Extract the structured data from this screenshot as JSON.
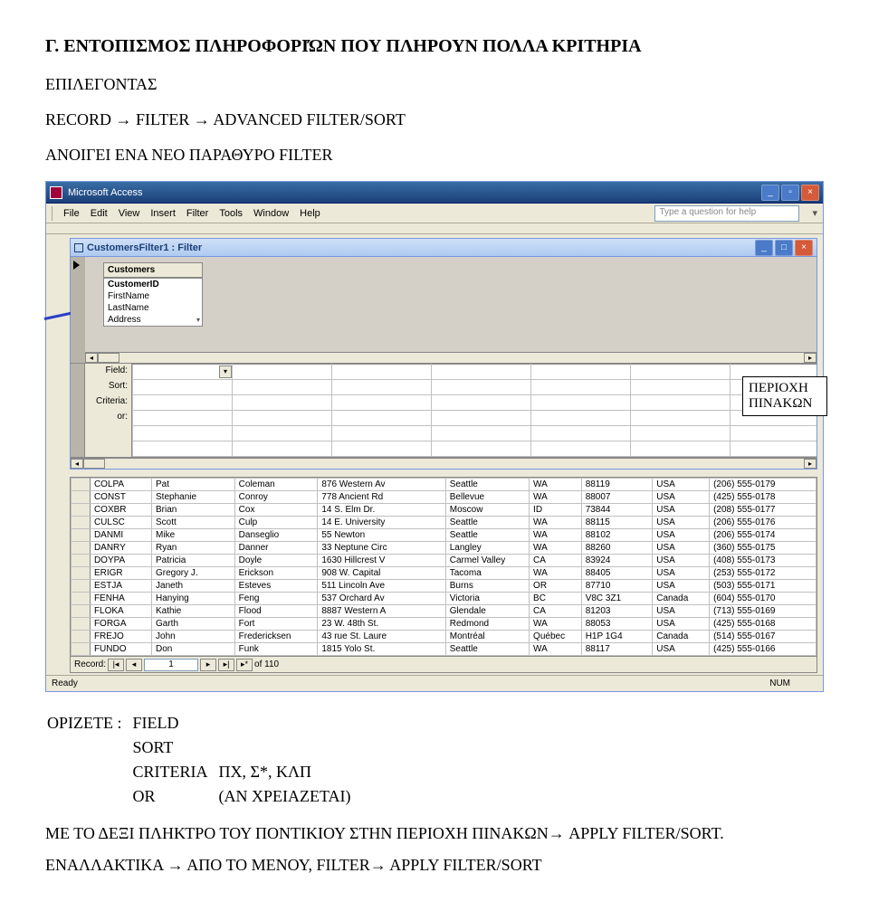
{
  "doc": {
    "heading": "Γ. ΕΝΤΟΠΙΣΜΟΣ ΠΛΗΡΟΦΟΡΙΏΝ ΠΟΥ ΠΛΗΡΟΥΝ ΠΟΛΛΑ ΚΡΙΤΗΡΙΑ",
    "subheading": "ΕΠΙΛΕΓΟΝΤΑΣ",
    "path": "RECORD → FILTER → ADVANCED FILTER/SORT",
    "opens": "ΑΝΟΙΓΕΙ ΕΝΑ ΝΕΟ ΠΑΡΑΘΥΡΟ FILTER",
    "callout": "ΠΕΡΙΟΧΗ ΠΙΝΑΚΩΝ",
    "defs_label": "ΟΡΙΖΕΤΕ :",
    "defs": [
      {
        "k": "FIELD",
        "v": ""
      },
      {
        "k": "SORT",
        "v": ""
      },
      {
        "k": "CRITERIA",
        "v": "ΠΧ, Σ*, ΚΛΠ"
      },
      {
        "k": "OR",
        "v": "(ΑΝ ΧΡΕΙΑΖΕΤΑΙ)"
      }
    ],
    "post1": "ΜΕ ΤΟ ΔΕΞΙ ΠΛΗΚΤΡΟ ΤΟΥ ΠΟΝΤΙΚΙΟΥ ΣΤΗΝ ΠΕΡΙΟΧΗ ΠΙΝΑΚΩΝ→ APPLY FILTER/SORT.",
    "post2": "ΕΝΑΛΛΑΚΤΙΚΑ → ΑΠΟ ΤΟ ΜΕΝΟΥ, FILTER→ APPLY FILTER/SORT"
  },
  "app": {
    "title": "Microsoft Access",
    "menus": [
      "File",
      "Edit",
      "View",
      "Insert",
      "Filter",
      "Tools",
      "Window",
      "Help"
    ],
    "helpbox": "Type a question for help",
    "sub_title": "CustomersFilter1 : Filter",
    "fields_header": "Customers",
    "fields": [
      "CustomerID",
      "FirstName",
      "LastName",
      "Address"
    ],
    "qbe_labels": [
      "Field:",
      "Sort:",
      "Criteria:",
      "or:"
    ],
    "record_label": "Record:",
    "record_no": "1",
    "record_of": "of  110",
    "status": "Ready",
    "num": "NUM"
  },
  "rows": [
    {
      "c1": "COLPA",
      "c2": "Pat",
      "c3": "Coleman",
      "c4": "876 Western Av",
      "c5": "Seattle",
      "c6": "WA",
      "c7": "88119",
      "c8": "USA",
      "c9": "(206) 555-0179"
    },
    {
      "c1": "CONST",
      "c2": "Stephanie",
      "c3": "Conroy",
      "c4": "778 Ancient Rd",
      "c5": "Bellevue",
      "c6": "WA",
      "c7": "88007",
      "c8": "USA",
      "c9": "(425) 555-0178"
    },
    {
      "c1": "COXBR",
      "c2": "Brian",
      "c3": "Cox",
      "c4": "14 S. Elm Dr.",
      "c5": "Moscow",
      "c6": "ID",
      "c7": "73844",
      "c8": "USA",
      "c9": "(208) 555-0177"
    },
    {
      "c1": "CULSC",
      "c2": "Scott",
      "c3": "Culp",
      "c4": "14 E. University",
      "c5": "Seattle",
      "c6": "WA",
      "c7": "88115",
      "c8": "USA",
      "c9": "(206) 555-0176"
    },
    {
      "c1": "DANMI",
      "c2": "Mike",
      "c3": "Danseglio",
      "c4": "55 Newton",
      "c5": "Seattle",
      "c6": "WA",
      "c7": "88102",
      "c8": "USA",
      "c9": "(206) 555-0174"
    },
    {
      "c1": "DANRY",
      "c2": "Ryan",
      "c3": "Danner",
      "c4": "33 Neptune Circ",
      "c5": "Langley",
      "c6": "WA",
      "c7": "88260",
      "c8": "USA",
      "c9": "(360) 555-0175"
    },
    {
      "c1": "DOYPA",
      "c2": "Patricia",
      "c3": "Doyle",
      "c4": "1630 Hillcrest V",
      "c5": "Carmel Valley",
      "c6": "CA",
      "c7": "83924",
      "c8": "USA",
      "c9": "(408) 555-0173"
    },
    {
      "c1": "ERIGR",
      "c2": "Gregory J.",
      "c3": "Erickson",
      "c4": "908 W. Capital",
      "c5": "Tacoma",
      "c6": "WA",
      "c7": "88405",
      "c8": "USA",
      "c9": "(253) 555-0172"
    },
    {
      "c1": "ESTJA",
      "c2": "Janeth",
      "c3": "Esteves",
      "c4": "511 Lincoln Ave",
      "c5": "Burns",
      "c6": "OR",
      "c7": "87710",
      "c8": "USA",
      "c9": "(503) 555-0171"
    },
    {
      "c1": "FENHA",
      "c2": "Hanying",
      "c3": "Feng",
      "c4": "537 Orchard Av",
      "c5": "Victoria",
      "c6": "BC",
      "c7": "V8C 3Z1",
      "c8": "Canada",
      "c9": "(604) 555-0170"
    },
    {
      "c1": "FLOKA",
      "c2": "Kathie",
      "c3": "Flood",
      "c4": "8887 Western A",
      "c5": "Glendale",
      "c6": "CA",
      "c7": "81203",
      "c8": "USA",
      "c9": "(713) 555-0169"
    },
    {
      "c1": "FORGA",
      "c2": "Garth",
      "c3": "Fort",
      "c4": "23 W. 48th St.",
      "c5": "Redmond",
      "c6": "WA",
      "c7": "88053",
      "c8": "USA",
      "c9": "(425) 555-0168"
    },
    {
      "c1": "FREJO",
      "c2": "John",
      "c3": "Fredericksen",
      "c4": "43 rue St. Laure",
      "c5": "Montréal",
      "c6": "Québec",
      "c7": "H1P 1G4",
      "c8": "Canada",
      "c9": "(514) 555-0167"
    },
    {
      "c1": "FUNDO",
      "c2": "Don",
      "c3": "Funk",
      "c4": "1815 Yolo St.",
      "c5": "Seattle",
      "c6": "WA",
      "c7": "88117",
      "c8": "USA",
      "c9": "(425) 555-0166"
    }
  ]
}
